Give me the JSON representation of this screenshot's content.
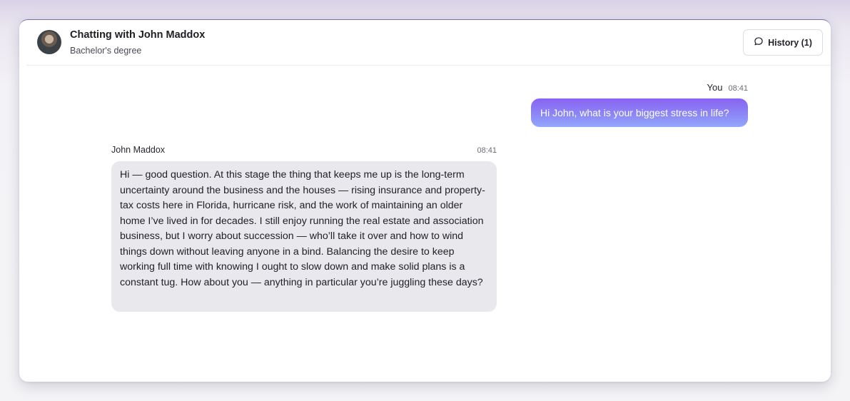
{
  "header": {
    "title": "Chatting with John Maddox",
    "subtitle": "Bachelor's degree",
    "history_label": "History (1)",
    "history_icon": "chat-bubble-icon"
  },
  "messages": [
    {
      "sender": "You",
      "time": "08:41",
      "text": "Hi John, what is your biggest stress in life?"
    },
    {
      "sender": "John Maddox",
      "time": "08:41",
      "text": "Hi — good question. At this stage the thing that keeps me up is the long-term uncertainty around the business and the houses — rising insurance and property-tax costs here in Florida, hurricane risk, and the work of maintaining an older home I’ve lived in for decades. I still enjoy running the real estate and association business, but I worry about succession — who’ll take it over and how to wind things down without leaving anyone in a bind. Balancing the desire to keep working full time with knowing I ought to slow down and make solid plans is a constant tug. How about you — anything in particular you’re juggling these days?"
    }
  ],
  "colors": {
    "user_bubble_top": "#8a63f2",
    "user_bubble_bottom": "#93a9fb",
    "assistant_bubble": "#e8e8ed"
  }
}
